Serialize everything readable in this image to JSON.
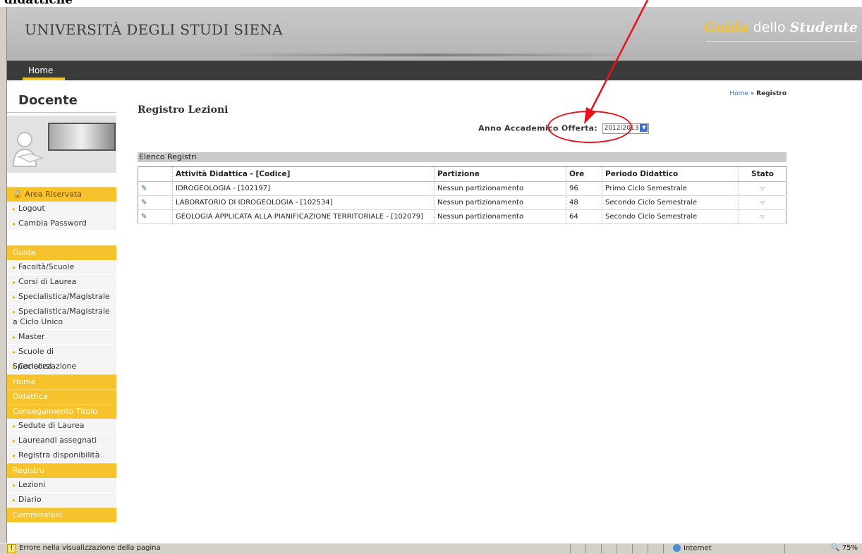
{
  "caption": "didattiche",
  "header": {
    "university": "UNIVERSITÀ DEGLI STUDI SIENA",
    "guida_part1": "Guida",
    "guida_part2": " dello ",
    "guida_part3": "Studente"
  },
  "nav": {
    "home": "Home"
  },
  "sidebar": {
    "title": "Docente",
    "area_riservata": "Area Riservata",
    "area_items": [
      "Logout",
      "Cambia Password"
    ],
    "guida": "Guida",
    "guida_items": [
      "Facoltà/Scuole",
      "Corsi di Laurea",
      "Specialistica/Magistrale",
      "Specialistica/Magistrale a Ciclo Unico",
      "Master",
      "Scuole di Specializzazione",
      "Concorsi"
    ],
    "home": "Home",
    "didattica": "Didattica",
    "conseguimento": "Conseguimento Titolo",
    "conseguimento_items": [
      "Sedute di Laurea",
      "Laureandi assegnati",
      "Registra disponibilità"
    ],
    "registro": "Registro",
    "registro_items": [
      "Lezioni",
      "Diario"
    ],
    "commissioni": "Commissioni"
  },
  "breadcrumb": {
    "home": "Home",
    "sep": " » ",
    "current": "Registro"
  },
  "main": {
    "title": "Registro Lezioni",
    "aa_label": "Anno Accademico Offerta:",
    "aa_value": "2012/2013",
    "list_title": "Elenco Registri"
  },
  "table": {
    "headers": [
      "Attività Didattica - [Codice]",
      "Partizione",
      "Ore",
      "Periodo Didattico",
      "Stato"
    ],
    "rows": [
      [
        "IDROGEOLOGIA - [102197]",
        "Nessun partizionamento",
        "96",
        "Primo Ciclo Semestrale"
      ],
      [
        "LABORATORIO DI IDROGEOLOGIA - [102534]",
        "Nessun partizionamento",
        "48",
        "Secondo Ciclo Semestrale"
      ],
      [
        "GEOLOGIA APPLICATA ALLA PIANIFICAZIONE TERRITORIALE - [102079]",
        "Nessun partizionamento",
        "64",
        "Secondo Ciclo Semestrale"
      ]
    ]
  },
  "statusbar": {
    "message": "Errore nella visualizzazione della pagina",
    "zone": "Internet",
    "zoom": "75%"
  },
  "colors": {
    "accent": "#f6c32c",
    "nav": "#3b3b3b",
    "annotation": "#e8121b"
  },
  "icons": {
    "row_icon": "register-entry-icon",
    "stato_icon": "filter-funnel-icon"
  }
}
